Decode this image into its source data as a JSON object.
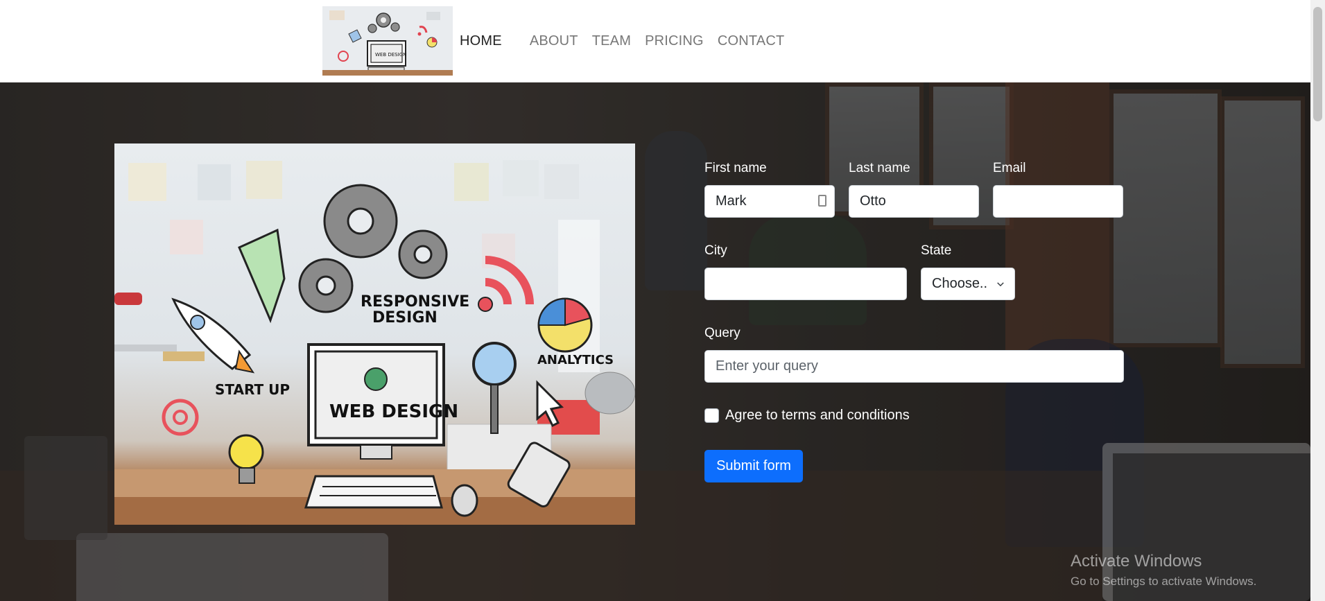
{
  "nav": {
    "logo_alt": "Responsive design web design illustration logo",
    "links": [
      {
        "label": "HOME",
        "active": true
      },
      {
        "label": "ABOUT",
        "active": false
      },
      {
        "label": "TEAM",
        "active": false
      },
      {
        "label": "PRICING",
        "active": false
      },
      {
        "label": "CONTACT",
        "active": false
      }
    ]
  },
  "illustration": {
    "text_responsive_1": "RESPONSIVE",
    "text_responsive_2": "DESIGN",
    "text_startup": "START UP",
    "text_web_design": "WEB DESIGN",
    "text_analytics": "ANALYTICS"
  },
  "form": {
    "first_name": {
      "label": "First name",
      "value": "Mark"
    },
    "last_name": {
      "label": "Last name",
      "value": "Otto"
    },
    "email": {
      "label": "Email",
      "value": ""
    },
    "city": {
      "label": "City",
      "value": ""
    },
    "state": {
      "label": "State",
      "selected": "Choose.."
    },
    "query": {
      "label": "Query",
      "placeholder": "Enter your query"
    },
    "agree": {
      "label": "Agree to terms and conditions",
      "checked": false
    },
    "submit_label": "Submit form"
  },
  "watermark": {
    "title": "Activate Windows",
    "subtitle": "Go to Settings to activate Windows."
  },
  "colors": {
    "primary_button": "#0d6efd",
    "nav_active": "#222222",
    "nav_inactive": "#777777"
  }
}
